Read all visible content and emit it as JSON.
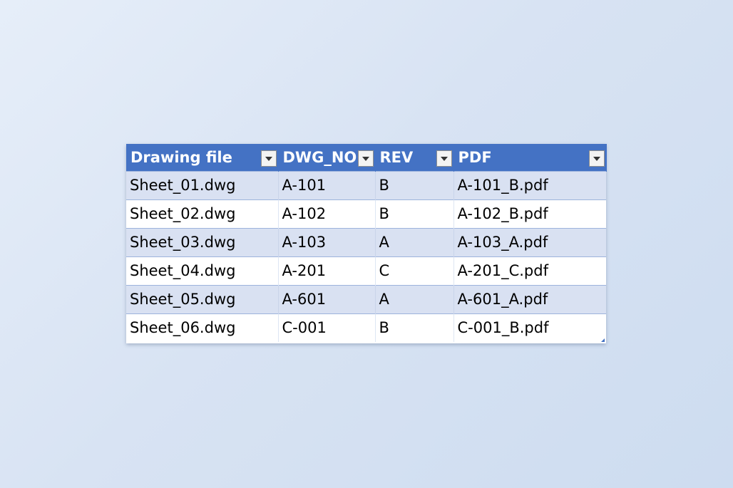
{
  "table": {
    "headers": [
      "Drawing file",
      "DWG_NO",
      "REV",
      "PDF"
    ],
    "rows": [
      [
        "Sheet_01.dwg",
        "A-101",
        "B",
        "A-101_B.pdf"
      ],
      [
        "Sheet_02.dwg",
        "A-102",
        "B",
        "A-102_B.pdf"
      ],
      [
        "Sheet_03.dwg",
        "A-103",
        "A",
        "A-103_A.pdf"
      ],
      [
        "Sheet_04.dwg",
        "A-201",
        "C",
        "A-201_C.pdf"
      ],
      [
        "Sheet_05.dwg",
        "A-601",
        "A",
        "A-601_A.pdf"
      ],
      [
        "Sheet_06.dwg",
        "C-001",
        "B",
        "C-001_B.pdf"
      ]
    ]
  },
  "icons": {
    "filter": "filter-dropdown-icon",
    "resize": "table-resize-handle-icon"
  },
  "colors": {
    "header_bg": "#4472c4",
    "header_text": "#ffffff",
    "band_row": "#d9e1f2",
    "plain_row": "#ffffff"
  }
}
